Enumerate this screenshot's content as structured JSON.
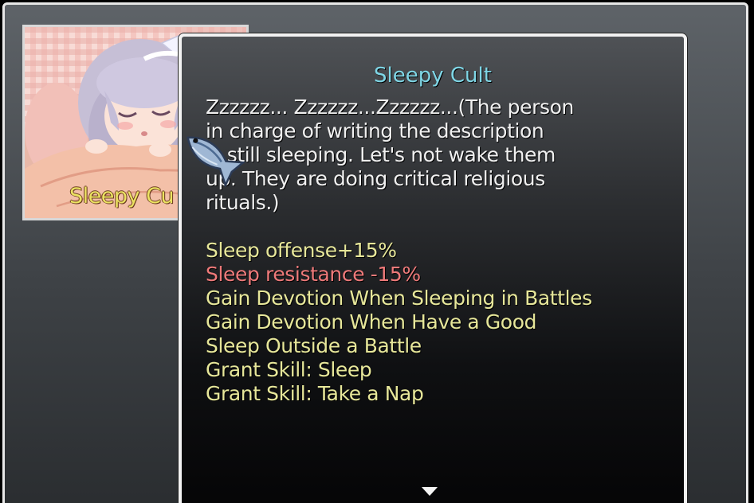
{
  "card": {
    "label": "Sleepy Cu",
    "image": "sleeping-girl-portrait"
  },
  "popup": {
    "title": "Sleepy Cult",
    "description": "Zzzzzz... Zzzzzz...Zzzzzz...(The person\nin charge of writing the description\nis still sleeping. Let's not wake them\nup. They are doing critical religious\nrituals.)",
    "effects": [
      {
        "text": "Sleep offense+15%",
        "color": "#e7e79a"
      },
      {
        "text": "Sleep resistance -15%",
        "color": "#ef7a7a"
      },
      {
        "text": "Gain Devotion When Sleeping in Battles",
        "color": "#e7e79a"
      },
      {
        "text": "Gain Devotion When Have a Good",
        "color": "#e7e79a"
      },
      {
        "text": "Sleep Outside a Battle",
        "color": "#e7e79a"
      },
      {
        "text": "Grant Skill: Sleep",
        "color": "#e7e79a"
      },
      {
        "text": "Grant Skill: Take a Nap",
        "color": "#e7e79a"
      }
    ]
  },
  "icons": {
    "cursor": "fish-cursor-icon",
    "more": "down-arrow-icon"
  },
  "colors": {
    "title": "#7fd6e6",
    "card_label": "#ebe262",
    "positive": "#e7e79a",
    "negative": "#ef7a7a"
  }
}
